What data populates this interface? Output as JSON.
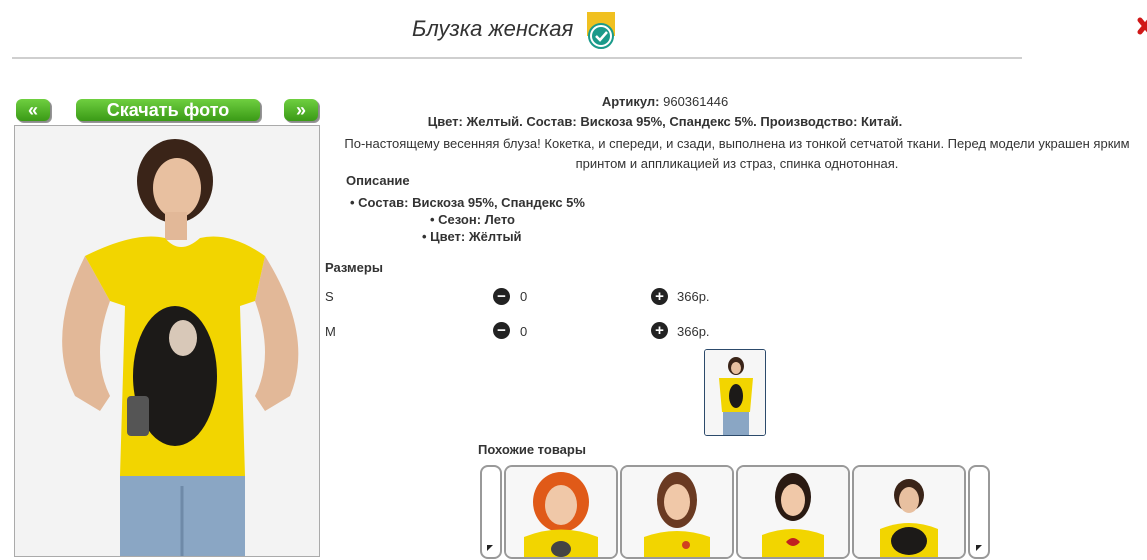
{
  "header": {
    "title": "Блузка женская"
  },
  "nav": {
    "prev_label": "«",
    "download_label": "Скачать фото",
    "next_label": "»"
  },
  "product": {
    "article_label": "Артикул:",
    "article_value": "960361446",
    "composition_line": "Цвет: Желтый. Состав: Вискоза 95%, Спандекс 5%. Производство: Китай.",
    "description": "По-настоящему весенняя блуза! Кокетка, и спереди, и сзади, выполнена из тонкой сетчатой ткани. Перед модели украшен ярким принтом и аппликацией из страз, спинка однотонная.",
    "details_heading": "Описание",
    "details": [
      "Состав: Вискоза 95%, Спандекс 5%",
      "Сезон: Лето",
      "Цвет: Жёлтый"
    ],
    "sizes_heading": "Размеры",
    "sizes": [
      {
        "label": "S",
        "qty": "0",
        "price": "366р."
      },
      {
        "label": "M",
        "qty": "0",
        "price": "366р."
      }
    ],
    "similar_heading": "Похожие товары"
  },
  "icons": {
    "badge": "verified-check-icon",
    "close": "close-icon",
    "minus": "minus-circle-icon",
    "plus": "plus-circle-icon"
  },
  "colors": {
    "accent_green": "#3a9a16",
    "badge_teal": "#1a9a8a",
    "badge_gold": "#f0c020",
    "shirt_yellow": "#f2d500"
  }
}
